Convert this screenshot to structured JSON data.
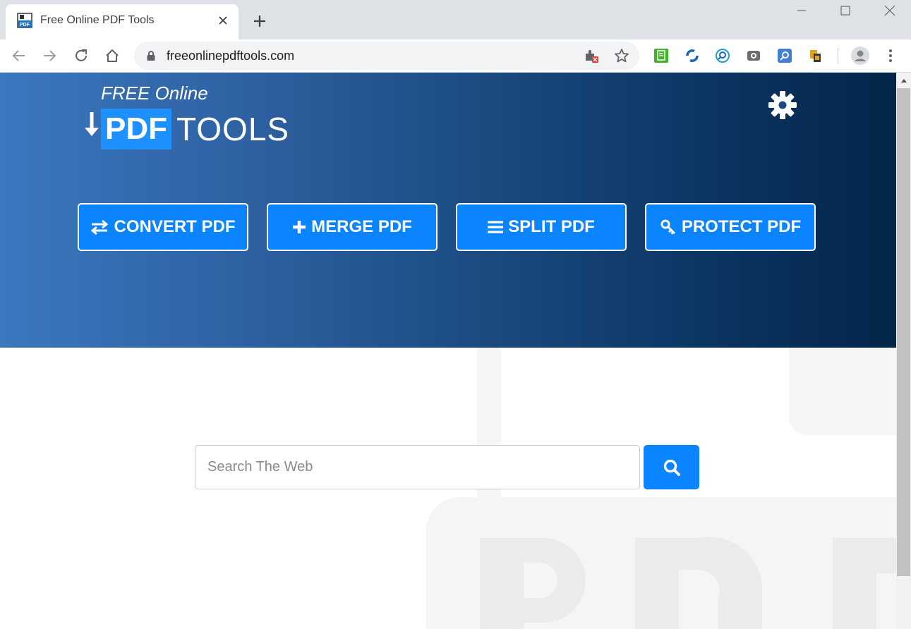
{
  "browser": {
    "tab_title": "Free Online PDF Tools",
    "url": "freeonlinepdftools.com"
  },
  "logo": {
    "line1": "FREE Online",
    "pdf": "PDF",
    "tools": "TOOLS"
  },
  "hero_buttons": [
    {
      "label": "CONVERT PDF",
      "icon": "swap-arrows-icon"
    },
    {
      "label": "MERGE PDF",
      "icon": "plus-icon"
    },
    {
      "label": "SPLIT PDF",
      "icon": "bars-icon"
    },
    {
      "label": "PROTECT PDF",
      "icon": "key-icon"
    }
  ],
  "search": {
    "placeholder": "Search The Web",
    "value": ""
  },
  "colors": {
    "accent": "#0a84ff",
    "hero_start": "#3b78bf",
    "hero_end": "#03264a"
  }
}
